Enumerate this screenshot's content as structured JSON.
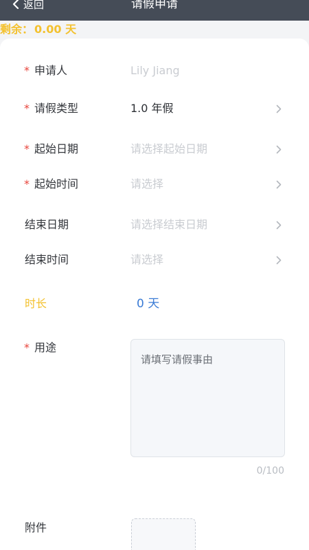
{
  "nav": {
    "back_label": "返回",
    "title": "请假申请"
  },
  "remaining": {
    "label": "剩余：",
    "value": "0.00 天"
  },
  "form": {
    "applicant": {
      "label": "申请人",
      "value": "Lily Jiang",
      "required": true
    },
    "leave_type": {
      "label": "请假类型",
      "value": "1.0 年假",
      "required": true
    },
    "start_date": {
      "label": "起始日期",
      "placeholder": "请选择起始日期",
      "required": true
    },
    "start_time": {
      "label": "起始时间",
      "placeholder": "请选择",
      "required": true
    },
    "end_date": {
      "label": "结束日期",
      "placeholder": "请选择结束日期",
      "required": false
    },
    "end_time": {
      "label": "结束时间",
      "placeholder": "请选择",
      "required": false
    },
    "duration": {
      "label": "时长",
      "value": "0 天"
    },
    "purpose": {
      "label": "用途",
      "placeholder": "请填写请假事由",
      "counter": "0/100",
      "required": true
    },
    "attachment": {
      "label": "附件"
    },
    "required_mark": "*"
  },
  "colors": {
    "nav_bg": "#454c57",
    "accent_yellow": "#f3c12e",
    "required_red": "#e8443b",
    "link_blue": "#3a7bd5"
  },
  "icons": {
    "back": "chevron-left-icon",
    "row_arrow": "chevron-right-icon"
  }
}
